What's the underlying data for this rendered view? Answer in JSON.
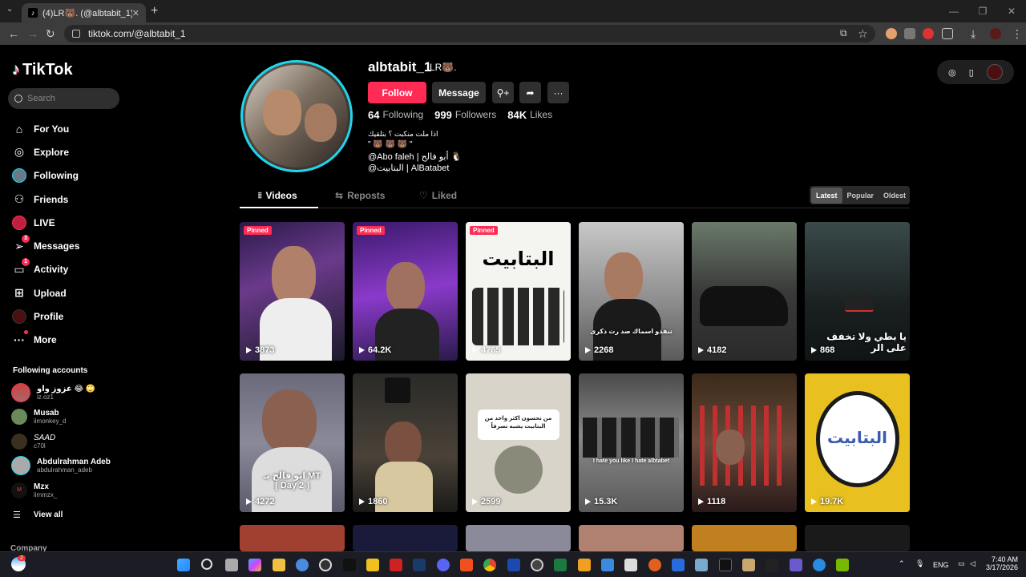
{
  "browser": {
    "tab_title": "(4)LR🐻. (@albtabit_1) | TikTok",
    "url": "tiktok.com/@albtabit_1"
  },
  "sidebar": {
    "logo": "TikTok",
    "search_placeholder": "Search",
    "items": [
      {
        "label": "For You",
        "icon": "home-icon"
      },
      {
        "label": "Explore",
        "icon": "compass-icon"
      },
      {
        "label": "Following",
        "icon": "following-avatar-icon"
      },
      {
        "label": "Friends",
        "icon": "friends-icon"
      },
      {
        "label": "LIVE",
        "icon": "live-icon"
      },
      {
        "label": "Messages",
        "icon": "messages-icon",
        "badge": "3"
      },
      {
        "label": "Activity",
        "icon": "activity-icon",
        "badge": "1"
      },
      {
        "label": "Upload",
        "icon": "upload-icon"
      },
      {
        "label": "Profile",
        "icon": "profile-avatar-icon"
      },
      {
        "label": "More",
        "icon": "more-icon"
      }
    ],
    "following_header": "Following accounts",
    "following": [
      {
        "name": "عزوز واو 😂 🙄",
        "handle": "iz.oz1"
      },
      {
        "name": "Musab",
        "handle": "iimonkey_d"
      },
      {
        "name": "SAAD",
        "handle": "c70l"
      },
      {
        "name": "Abdulrahman Adeb",
        "handle": "abdulrahman_adeb"
      },
      {
        "name": "Mzx",
        "handle": "iimmzx_"
      }
    ],
    "view_all": "View all",
    "company": "Company"
  },
  "profile": {
    "username": "albtabit_1",
    "nickname": "LR🐻.",
    "follow_label": "Follow",
    "message_label": "Message",
    "following_count": "64",
    "following_label": "Following",
    "followers_count": "999",
    "followers_label": "Followers",
    "likes_count": "84K",
    "likes_label": "Likes",
    "bio_line1": "اذا ملت منكبت ؟ بتلقيك",
    "bio_line2": "\" 🐻 🐻 🐻 \"",
    "bio_line3": "@Abo faleh | أبو فالح 🐧",
    "bio_line4": "@البتابيت | AlBatabet"
  },
  "tabs": {
    "videos": "Videos",
    "reposts": "Reposts",
    "liked": "Liked"
  },
  "sort": {
    "latest": "Latest",
    "popular": "Popular",
    "oldest": "Oldest"
  },
  "videos": [
    {
      "views": "3873",
      "pinned": "Pinned",
      "caption": ""
    },
    {
      "views": "64.2K",
      "pinned": "Pinned",
      "caption": ""
    },
    {
      "views": "4765",
      "pinned": "Pinned",
      "caption": "البتابيت"
    },
    {
      "views": "2268",
      "pinned": "",
      "caption": "تنفذو اسماك صد رت ذكرى"
    },
    {
      "views": "4182",
      "pinned": "",
      "caption": ""
    },
    {
      "views": "868",
      "pinned": "",
      "caption": "يا بطي ولا تخفف على الر"
    },
    {
      "views": "4272",
      "pinned": "",
      "caption": "ابو فالح بـ MT\n[ Day 2 ]"
    },
    {
      "views": "1860",
      "pinned": "",
      "caption": ""
    },
    {
      "views": "2599",
      "pinned": "",
      "caption": "من تحسون اكثر واحد من البتابيت يشبه تصرفاً"
    },
    {
      "views": "15.3K",
      "pinned": "",
      "caption": "I hate you like I hate albtabet"
    },
    {
      "views": "1118",
      "pinned": "",
      "caption": ""
    },
    {
      "views": "19.7K",
      "pinned": "",
      "caption": "البتابيت"
    }
  ],
  "taskbar": {
    "lang": "ENG",
    "time": "7:40 AM",
    "date": "3/17/2026",
    "notif": "2"
  }
}
